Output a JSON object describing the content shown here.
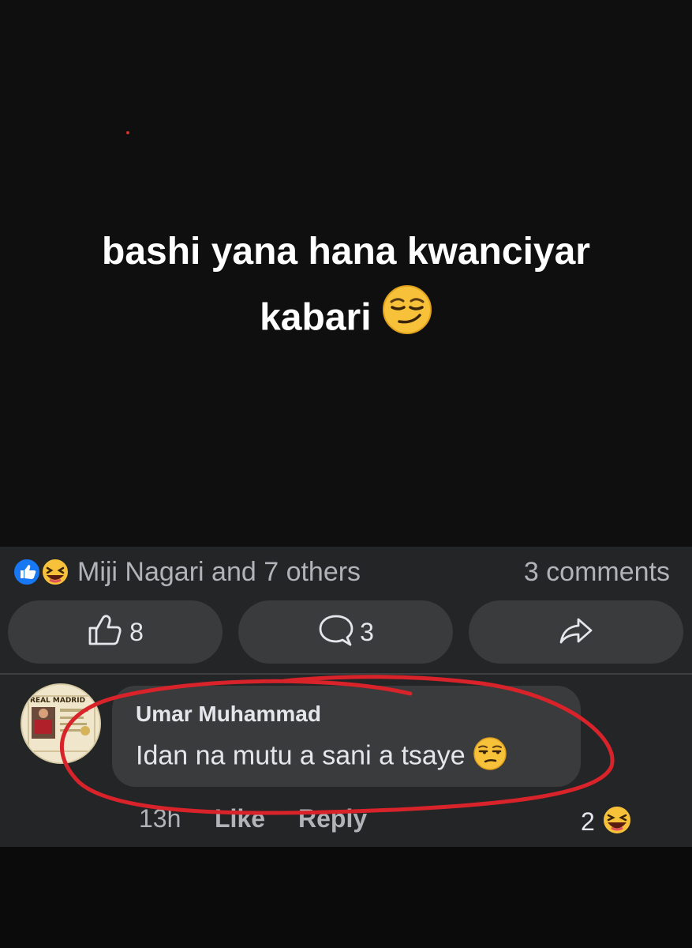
{
  "post": {
    "text_line1": "bashi yana hana kwanciyar",
    "text_line2": "kabari",
    "emoji": "smirking-face"
  },
  "reactions": {
    "icons": [
      "like-reaction",
      "haha-reaction"
    ],
    "summary": "Miji Nagari and 7 others",
    "comments_label": "3 comments"
  },
  "actions": {
    "like_count": "8",
    "comment_count": "3"
  },
  "comment": {
    "author": "Umar Muhammad",
    "text": "Idan na mutu a sani a tsaye",
    "emoji": "unamused-face",
    "time": "13h",
    "like_label": "Like",
    "reply_label": "Reply",
    "reaction_count": "2",
    "reaction_icon": "haha-reaction",
    "avatar_text": "REAL MADRID"
  },
  "colors": {
    "like_blue": "#1877f2",
    "emoji_yellow": "#f7c13a",
    "annotation_red": "#d8232a",
    "panel_bg": "#242526",
    "button_bg": "#3a3b3c"
  }
}
